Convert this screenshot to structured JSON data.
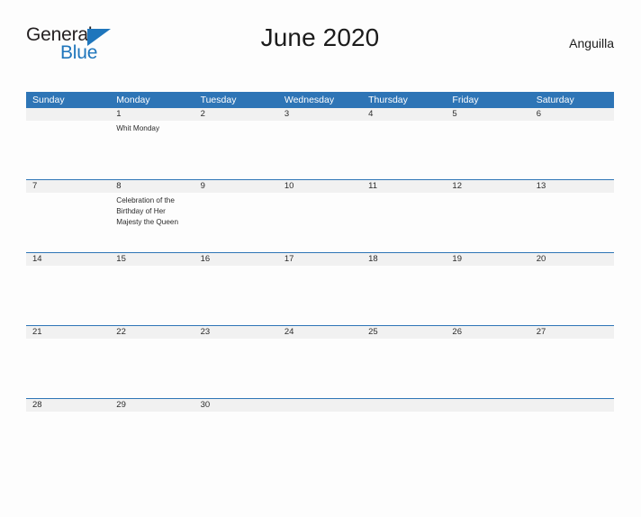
{
  "brand": {
    "name_part1": "General",
    "name_part2": "Blue",
    "triangle_color": "#1f76bc",
    "text_color": "#231f20"
  },
  "header": {
    "title": "June 2020",
    "region": "Anguilla"
  },
  "theme": {
    "header_blue": "#2e75b6",
    "date_band_gray": "#f1f1f1",
    "page_background": "#fdfdfd",
    "text_color": "#2b2b2b"
  },
  "calendar": {
    "weekdays": [
      "Sunday",
      "Monday",
      "Tuesday",
      "Wednesday",
      "Thursday",
      "Friday",
      "Saturday"
    ],
    "weeks": [
      {
        "days": [
          {
            "date": "",
            "event": ""
          },
          {
            "date": "1",
            "event": "Whit Monday"
          },
          {
            "date": "2",
            "event": ""
          },
          {
            "date": "3",
            "event": ""
          },
          {
            "date": "4",
            "event": ""
          },
          {
            "date": "5",
            "event": ""
          },
          {
            "date": "6",
            "event": ""
          }
        ]
      },
      {
        "days": [
          {
            "date": "7",
            "event": ""
          },
          {
            "date": "8",
            "event": "Celebration of the Birthday of Her Majesty the Queen"
          },
          {
            "date": "9",
            "event": ""
          },
          {
            "date": "10",
            "event": ""
          },
          {
            "date": "11",
            "event": ""
          },
          {
            "date": "12",
            "event": ""
          },
          {
            "date": "13",
            "event": ""
          }
        ]
      },
      {
        "days": [
          {
            "date": "14",
            "event": ""
          },
          {
            "date": "15",
            "event": ""
          },
          {
            "date": "16",
            "event": ""
          },
          {
            "date": "17",
            "event": ""
          },
          {
            "date": "18",
            "event": ""
          },
          {
            "date": "19",
            "event": ""
          },
          {
            "date": "20",
            "event": ""
          }
        ]
      },
      {
        "days": [
          {
            "date": "21",
            "event": ""
          },
          {
            "date": "22",
            "event": ""
          },
          {
            "date": "23",
            "event": ""
          },
          {
            "date": "24",
            "event": ""
          },
          {
            "date": "25",
            "event": ""
          },
          {
            "date": "26",
            "event": ""
          },
          {
            "date": "27",
            "event": ""
          }
        ]
      },
      {
        "days": [
          {
            "date": "28",
            "event": ""
          },
          {
            "date": "29",
            "event": ""
          },
          {
            "date": "30",
            "event": ""
          },
          {
            "date": "",
            "event": ""
          },
          {
            "date": "",
            "event": ""
          },
          {
            "date": "",
            "event": ""
          },
          {
            "date": "",
            "event": ""
          }
        ]
      }
    ]
  }
}
